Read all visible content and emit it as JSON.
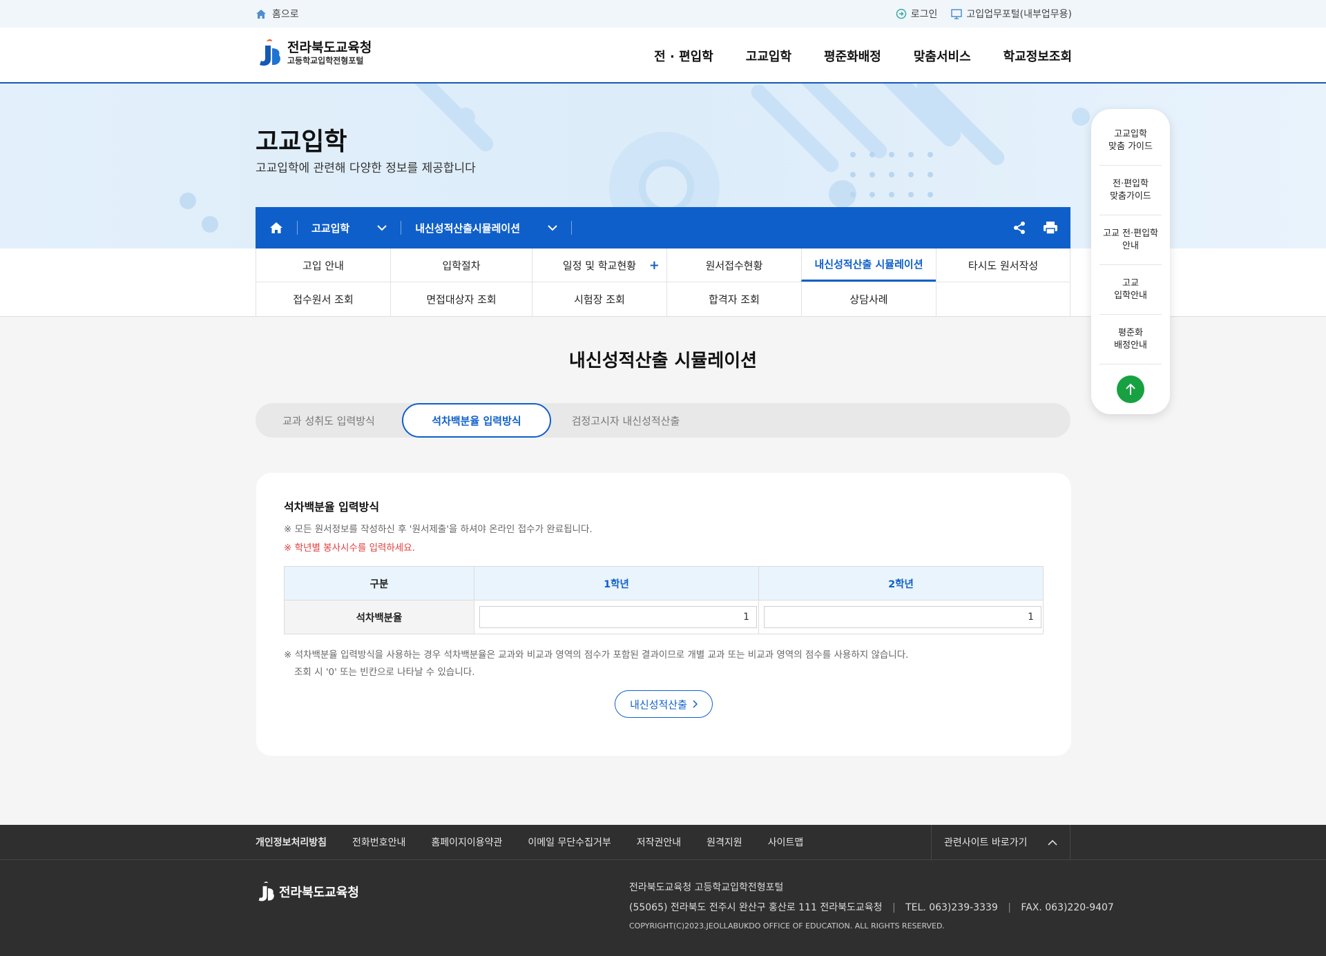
{
  "topbar": {
    "home_label": "홈으로",
    "login_label": "로그인",
    "portal_label": "고입업무포털(내부업무용)"
  },
  "header": {
    "logo_name": "전라북도교육청",
    "logo_sub": "고등학교입학전형포털",
    "gnb": [
      "전 · 편입학",
      "고교입학",
      "평준화배정",
      "맞춤서비스",
      "학교정보조회"
    ]
  },
  "hero": {
    "title": "고교입학",
    "description": "고교입학에 관련해 다양한 정보를 제공합니다"
  },
  "location": {
    "crumb1": "고교입학",
    "crumb2": "내신성적산출시뮬레이션"
  },
  "subnav": {
    "row1": [
      "고입 안내",
      "입학절차",
      "일정 및 학교현황",
      "원서접수현황",
      "내신성적산출 시뮬레이션",
      "타시도 원서작성"
    ],
    "row2": [
      "접수원서 조회",
      "면접대상자 조회",
      "시험장 조회",
      "합격자 조회",
      "상담사례",
      ""
    ],
    "plus": "+"
  },
  "main": {
    "page_title": "내신성적산출 시뮬레이션",
    "tabs": [
      "교과 성취도 입력방식",
      "석차백분율 입력방식",
      "검정고시자 내신성적산출"
    ],
    "card": {
      "title": "석차백분율 입력방식",
      "note1": "※ 모든 원서정보를 작성하신 후 '원서제출'을 하셔야 온라인 접수가 완료됩니다.",
      "note2": "※ 학년별 봉사시수를 입력하세요.",
      "table": {
        "headers": [
          "구분",
          "1학년",
          "2학년"
        ],
        "row_label": "석차백분율",
        "values": [
          "1",
          "1"
        ]
      },
      "foot1": "※ 석차백분율 입력방식을 사용하는 경우 석차백분율은 교과와 비교과 영역의 점수가 포함된 결과이므로 개별 교과 또는 비교과 영역의 점수를 사용하지 않습니다.",
      "foot2": "조회 시 '0' 또는 빈칸으로 나타날 수 있습니다.",
      "button_label": "내신성적산출"
    }
  },
  "quick": {
    "items": [
      "고교입학\n맞춤 가이드",
      "전·편입학\n맞춤가이드",
      "고교 전·편입학\n안내",
      "고교\n입학안내",
      "평준화\n배정안내"
    ]
  },
  "footer": {
    "links": [
      "개인정보처리방침",
      "전화번호안내",
      "홈페이지이용약관",
      "이메일 무단수집거부",
      "저작권안내",
      "원격지원",
      "사이트맵"
    ],
    "related": "관련사이트 바로가기",
    "logo_name": "전라북도교육청",
    "org": "전라북도교육청 고등학교입학전형포털",
    "address": "(55065) 전라북도 전주시 완산구 홍산로 111 전라북도교육청",
    "tel": "TEL. 063)239-3339",
    "fax": "FAX. 063)220-9407",
    "copyright": "COPYRIGHT(C)2023.JEOLLABUKDO OFFICE OF EDUCATION. ALL RIGHTS RESERVED."
  },
  "colors": {
    "brand_blue": "#0f5fca",
    "alert_red": "#e23c3c",
    "top_green": "#18a141",
    "footer_bg": "#2f2f2f"
  }
}
